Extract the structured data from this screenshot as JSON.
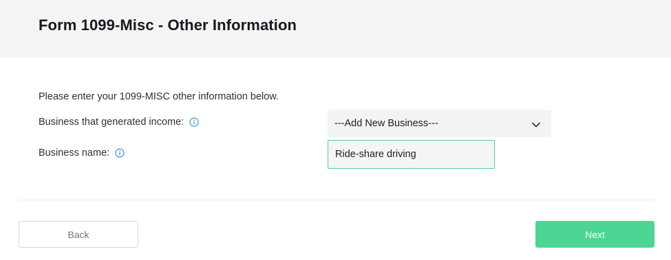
{
  "header": {
    "title": "Form 1099-Misc - Other Information"
  },
  "form": {
    "intro": "Please enter your 1099-MISC other information below.",
    "business_select": {
      "label": "Business that generated income:",
      "selected_value": "---Add New Business---"
    },
    "business_name": {
      "label": "Business name:",
      "value": "Ride-share driving"
    }
  },
  "footer": {
    "back_label": "Back",
    "next_label": "Next"
  },
  "colors": {
    "accent": "#4cd593",
    "info_icon": "#3b8fd6",
    "header_bg": "#f3f4f5"
  }
}
